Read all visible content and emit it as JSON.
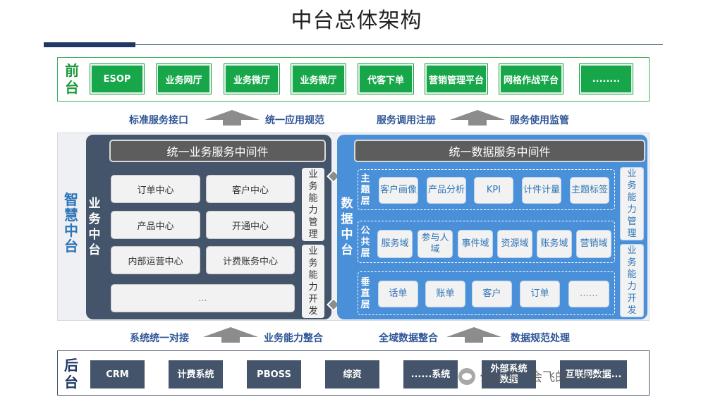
{
  "title": "中台总体架构",
  "front": {
    "label": "前台",
    "buttons": [
      "ESOP",
      "业务网厅",
      "业务微厅",
      "业务微厅",
      "代客下单",
      "营销管理平台",
      "网格作战平台",
      "........"
    ]
  },
  "top_arrows": {
    "left_before": "标准服务接口",
    "left_after": "统一应用规范",
    "right_before": "服务调用注册",
    "right_after": "服务使用监管"
  },
  "middle": {
    "label": "智慧中台",
    "business": {
      "label": "业务中台",
      "middleware": "统一业务服务中间件",
      "centers": [
        "订单中心",
        "客户中心",
        "产品中心",
        "开通中心",
        "内部运营中心",
        "计费账务中心",
        "..."
      ],
      "manage_label": "业务能力管理",
      "develop_label": "业务能力开发"
    },
    "data": {
      "label": "数据中台",
      "middleware": "统一数据服务中间件",
      "rows": [
        {
          "label": "主题层",
          "items": [
            "客户画像",
            "产品分析",
            "KPI",
            "计件计量",
            "主题标签"
          ]
        },
        {
          "label": "公共层",
          "items": [
            "服务域",
            "参与人域",
            "事件域",
            "资源域",
            "账务域",
            "营销域"
          ]
        },
        {
          "label": "垂直层",
          "items": [
            "话单",
            "账单",
            "客户",
            "订单",
            "……"
          ]
        }
      ],
      "manage_label": "业务能力管理",
      "develop_label": "业务能力开发"
    }
  },
  "bottom_arrows": {
    "left_before": "系统统一对接",
    "left_after": "业务能力整合",
    "right_before": "全域数据整合",
    "right_after": "数据规范处理"
  },
  "back": {
    "label": "后台",
    "buttons": [
      "CRM",
      "计费系统",
      "PBOSS",
      "综资",
      "......系统",
      "外部系统数据",
      "互联网数据..."
    ]
  },
  "watermark": "公众号 · 会飞的一十六",
  "colors": {
    "green": "#17a74a",
    "navy": "#44546a",
    "blue": "#4a90d9",
    "label_blue": "#2e75b6"
  }
}
